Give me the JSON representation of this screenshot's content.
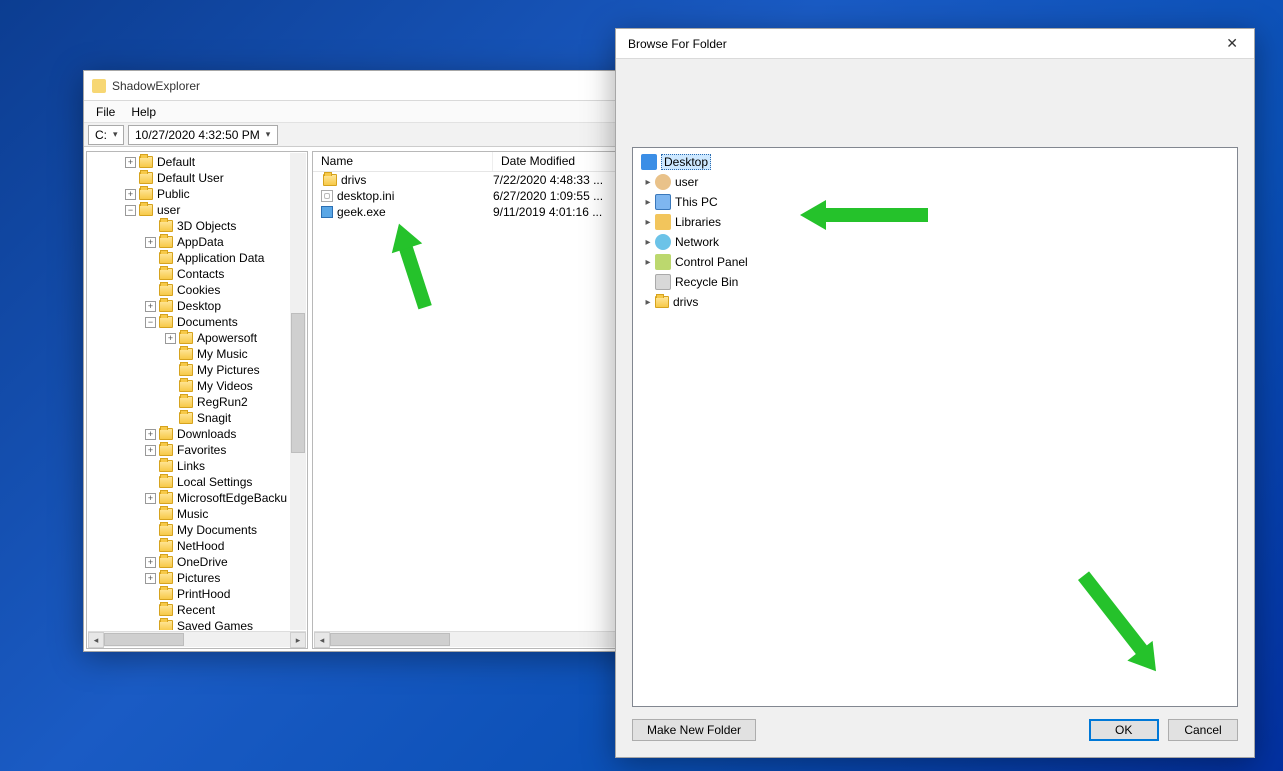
{
  "shadow_explorer": {
    "title": "ShadowExplorer",
    "menu": {
      "file": "File",
      "help": "Help"
    },
    "drive": "C:",
    "datetime": "10/27/2020 4:32:50 PM",
    "columns": {
      "name": "Name",
      "date": "Date Modified"
    },
    "tree": {
      "default": "Default",
      "default_user": "Default User",
      "public": "Public",
      "user": "user",
      "three_d": "3D Objects",
      "appdata": "AppData",
      "appdata2": "Application Data",
      "contacts": "Contacts",
      "cookies": "Cookies",
      "desktop": "Desktop",
      "documents": "Documents",
      "apowersoft": "Apowersoft",
      "my_music": "My Music",
      "my_pictures": "My Pictures",
      "my_videos": "My Videos",
      "regrun2": "RegRun2",
      "snagit": "Snagit",
      "downloads": "Downloads",
      "favorites": "Favorites",
      "links": "Links",
      "local_settings": "Local Settings",
      "edge": "MicrosoftEdgeBacku",
      "music": "Music",
      "my_documents": "My Documents",
      "nethood": "NetHood",
      "onedrive": "OneDrive",
      "pictures": "Pictures",
      "printhood": "PrintHood",
      "recent": "Recent",
      "saved_games": "Saved Games"
    },
    "rows": [
      {
        "name": "drivs",
        "date": "7/22/2020 4:48:33 ...",
        "type": "folder"
      },
      {
        "name": "desktop.ini",
        "date": "6/27/2020 1:09:55 ...",
        "type": "ini"
      },
      {
        "name": "geek.exe",
        "date": "9/11/2019 4:01:16 ...",
        "type": "exe"
      }
    ]
  },
  "browse": {
    "title": "Browse For Folder",
    "desktop": "Desktop",
    "user": "user",
    "this_pc": "This PC",
    "libraries": "Libraries",
    "network": "Network",
    "control_panel": "Control Panel",
    "recycle_bin": "Recycle Bin",
    "drivs": "drivs",
    "make_new": "Make New Folder",
    "ok": "OK",
    "cancel": "Cancel"
  }
}
